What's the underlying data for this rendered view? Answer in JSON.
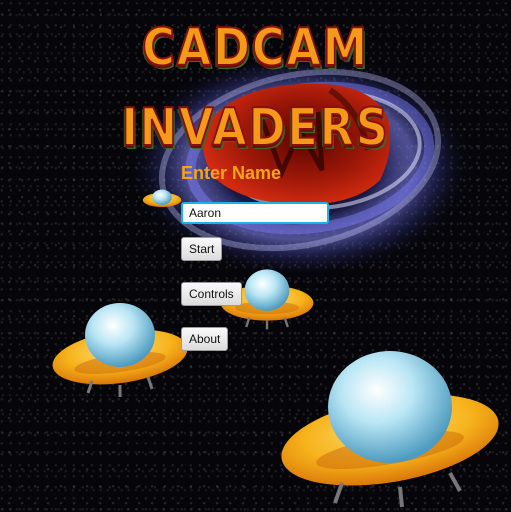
{
  "title": "CADCAM INVADERS",
  "menu": {
    "name_label": "Enter Name",
    "name_value": "Aaron",
    "start_label": "Start",
    "controls_label": "Controls",
    "about_label": "About"
  },
  "colors": {
    "title_fill": "#f39a1b",
    "title_outline": "#8a1010",
    "label": "#f5a31d",
    "input_border": "#1ab3e8",
    "vortex": "#8a8cff",
    "vortex_core": "#8a1206",
    "ufo_body": "#f6b21a",
    "ufo_dome": "#a9dcef"
  },
  "icons": [
    "black-hole-vortex",
    "ufo-saucer"
  ]
}
